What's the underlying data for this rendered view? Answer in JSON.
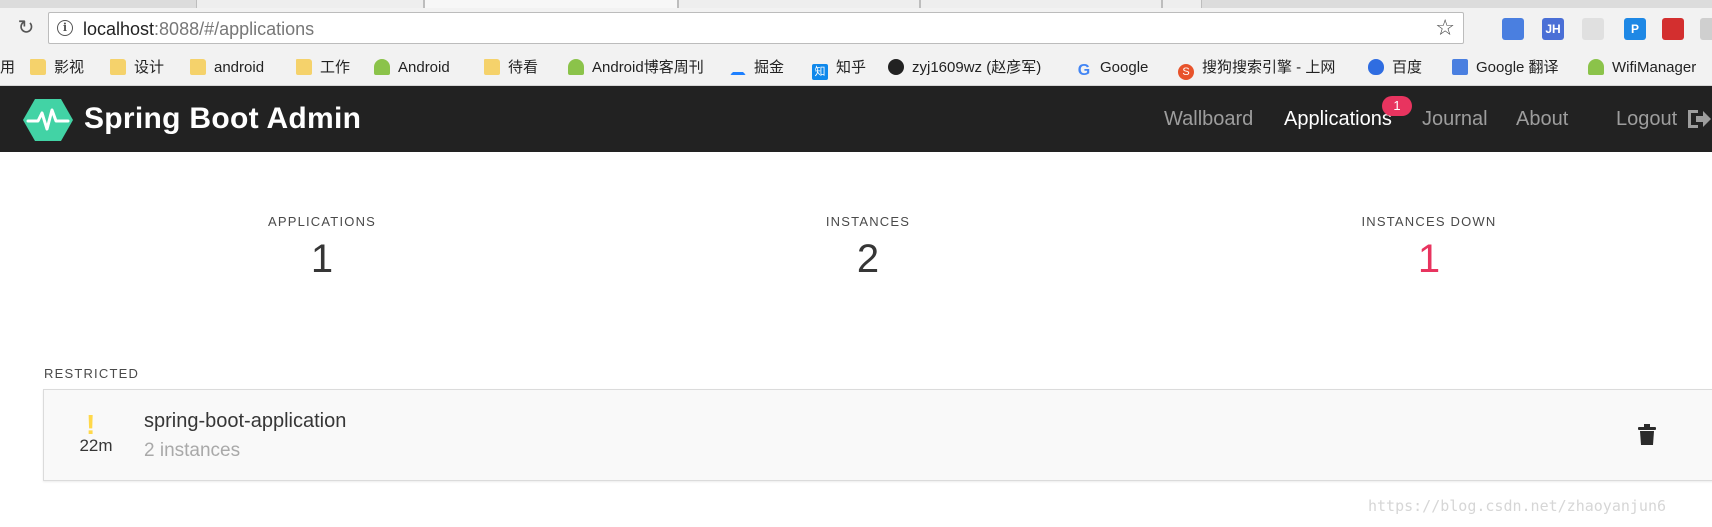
{
  "browser": {
    "url_host": "localhost",
    "url_rest": ":8088/#/applications",
    "extensions": [
      {
        "name": "google-translate-icon",
        "text": "",
        "color": "#4a7fe0"
      },
      {
        "name": "jsonhandle-icon",
        "text": "JH",
        "color": "#4a6fd6"
      },
      {
        "name": "sitemap-icon",
        "text": "",
        "color": "#e0e0e0"
      },
      {
        "name": "p-icon",
        "text": "P",
        "color": "#1e88e5"
      },
      {
        "name": "opera-icon",
        "text": "",
        "color": "#d32f2f"
      },
      {
        "name": "extension-icon",
        "text": "",
        "color": "#cfcfcf"
      }
    ],
    "bookmarks": [
      {
        "label": "用",
        "icon": "none"
      },
      {
        "label": "影视",
        "icon": "folder"
      },
      {
        "label": "设计",
        "icon": "folder"
      },
      {
        "label": "android",
        "icon": "folder"
      },
      {
        "label": "工作",
        "icon": "folder"
      },
      {
        "label": "Android",
        "icon": "android"
      },
      {
        "label": "待看",
        "icon": "folder"
      },
      {
        "label": "Android博客周刊",
        "icon": "android"
      },
      {
        "label": "掘金",
        "icon": "juejin"
      },
      {
        "label": "知乎",
        "icon": "zhihu"
      },
      {
        "label": "zyj1609wz (赵彦军)",
        "icon": "github"
      },
      {
        "label": "Google",
        "icon": "google"
      },
      {
        "label": "搜狗搜索引擎 - 上网",
        "icon": "sogou"
      },
      {
        "label": "百度",
        "icon": "baidu"
      },
      {
        "label": "Google 翻译",
        "icon": "translate"
      },
      {
        "label": "WifiManager",
        "icon": "android"
      }
    ]
  },
  "navbar": {
    "brand": "Spring Boot Admin",
    "links": {
      "wallboard": "Wallboard",
      "applications": "Applications",
      "journal": "Journal",
      "about": "About",
      "logout": "Logout"
    },
    "applications_badge": "1",
    "accent_color": "#42d3a5"
  },
  "stats": {
    "applications": {
      "label": "APPLICATIONS",
      "value": "1"
    },
    "instances": {
      "label": "INSTANCES",
      "value": "2"
    },
    "instances_down": {
      "label": "INSTANCES DOWN",
      "value": "1",
      "color": "#e8345f"
    }
  },
  "group": {
    "title": "RESTRICTED",
    "applications": [
      {
        "status_icon": "warning-icon",
        "status_symbol": "!",
        "status_color": "#ffd84a",
        "since": "22m",
        "name": "spring-boot-application",
        "instances": "2 instances"
      }
    ]
  },
  "watermark": "https://blog.csdn.net/zhaoyanjun6"
}
